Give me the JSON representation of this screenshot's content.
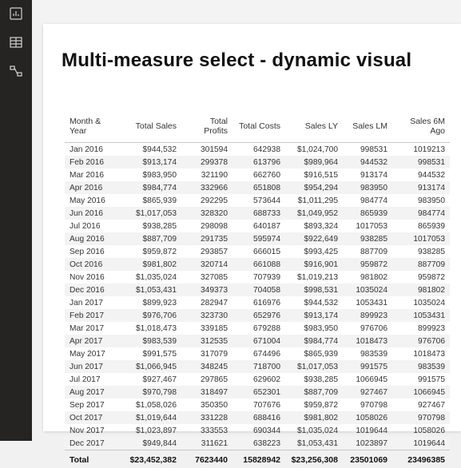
{
  "title": "Multi-measure select - dynamic visual",
  "columns": [
    "Month & Year",
    "Total Sales",
    "Total Profits",
    "Total Costs",
    "Sales LY",
    "Sales LM",
    "Sales 6M Ago"
  ],
  "rows": [
    [
      "Jan 2016",
      "$944,532",
      "301594",
      "642938",
      "$1,024,700",
      "998531",
      "1019213"
    ],
    [
      "Feb 2016",
      "$913,174",
      "299378",
      "613796",
      "$989,964",
      "944532",
      "998531"
    ],
    [
      "Mar 2016",
      "$983,950",
      "321190",
      "662760",
      "$916,515",
      "913174",
      "944532"
    ],
    [
      "Apr 2016",
      "$984,774",
      "332966",
      "651808",
      "$954,294",
      "983950",
      "913174"
    ],
    [
      "May 2016",
      "$865,939",
      "292295",
      "573644",
      "$1,011,295",
      "984774",
      "983950"
    ],
    [
      "Jun 2016",
      "$1,017,053",
      "328320",
      "688733",
      "$1,049,952",
      "865939",
      "984774"
    ],
    [
      "Jul 2016",
      "$938,285",
      "298098",
      "640187",
      "$893,324",
      "1017053",
      "865939"
    ],
    [
      "Aug 2016",
      "$887,709",
      "291735",
      "595974",
      "$922,649",
      "938285",
      "1017053"
    ],
    [
      "Sep 2016",
      "$959,872",
      "293857",
      "666015",
      "$993,425",
      "887709",
      "938285"
    ],
    [
      "Oct 2016",
      "$981,802",
      "320714",
      "661088",
      "$916,901",
      "959872",
      "887709"
    ],
    [
      "Nov 2016",
      "$1,035,024",
      "327085",
      "707939",
      "$1,019,213",
      "981802",
      "959872"
    ],
    [
      "Dec 2016",
      "$1,053,431",
      "349373",
      "704058",
      "$998,531",
      "1035024",
      "981802"
    ],
    [
      "Jan 2017",
      "$899,923",
      "282947",
      "616976",
      "$944,532",
      "1053431",
      "1035024"
    ],
    [
      "Feb 2017",
      "$976,706",
      "323730",
      "652976",
      "$913,174",
      "899923",
      "1053431"
    ],
    [
      "Mar 2017",
      "$1,018,473",
      "339185",
      "679288",
      "$983,950",
      "976706",
      "899923"
    ],
    [
      "Apr 2017",
      "$983,539",
      "312535",
      "671004",
      "$984,774",
      "1018473",
      "976706"
    ],
    [
      "May 2017",
      "$991,575",
      "317079",
      "674496",
      "$865,939",
      "983539",
      "1018473"
    ],
    [
      "Jun 2017",
      "$1,066,945",
      "348245",
      "718700",
      "$1,017,053",
      "991575",
      "983539"
    ],
    [
      "Jul 2017",
      "$927,467",
      "297865",
      "629602",
      "$938,285",
      "1066945",
      "991575"
    ],
    [
      "Aug 2017",
      "$970,798",
      "318497",
      "652301",
      "$887,709",
      "927467",
      "1066945"
    ],
    [
      "Sep 2017",
      "$1,058,026",
      "350350",
      "707676",
      "$959,872",
      "970798",
      "927467"
    ],
    [
      "Oct 2017",
      "$1,019,644",
      "331228",
      "688416",
      "$981,802",
      "1058026",
      "970798"
    ],
    [
      "Nov 2017",
      "$1,023,897",
      "333553",
      "690344",
      "$1,035,024",
      "1019644",
      "1058026"
    ],
    [
      "Dec 2017",
      "$949,844",
      "311621",
      "638223",
      "$1,053,431",
      "1023897",
      "1019644"
    ]
  ],
  "totals": [
    "Total",
    "$23,452,382",
    "7623440",
    "15828942",
    "$23,256,308",
    "23501069",
    "23496385"
  ]
}
